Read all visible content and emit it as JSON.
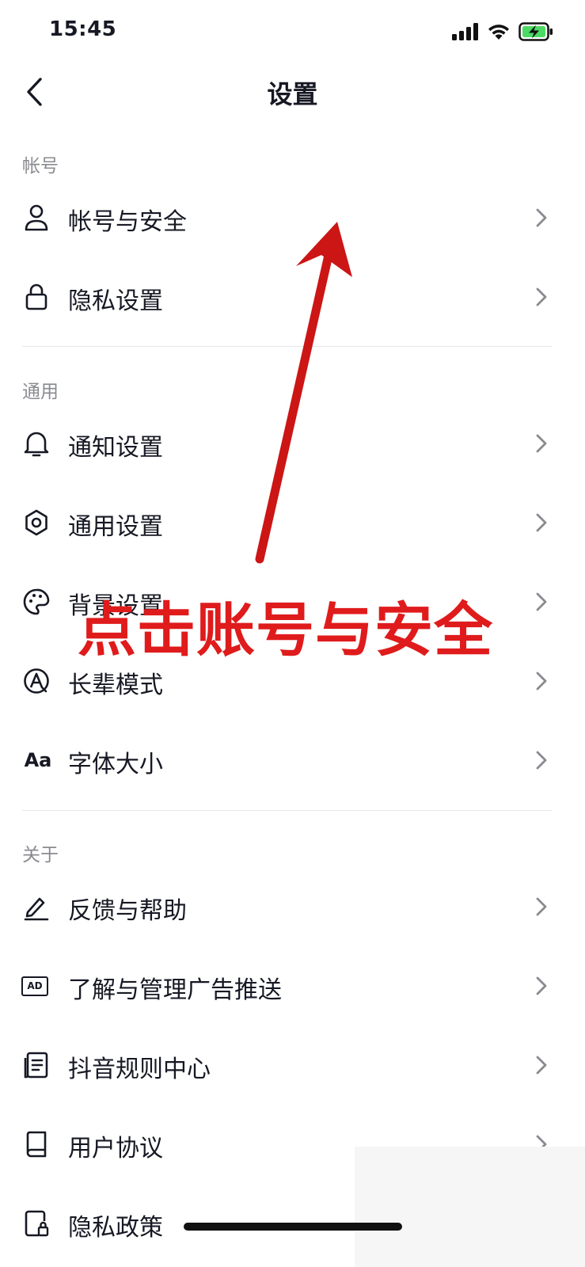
{
  "status_bar": {
    "time": "15:45",
    "battery_color": "#4cd964"
  },
  "header": {
    "title": "设置"
  },
  "sections": [
    {
      "label": "帐号",
      "items": [
        {
          "label": "帐号与安全",
          "icon": "person-icon"
        },
        {
          "label": "隐私设置",
          "icon": "lock-icon"
        }
      ]
    },
    {
      "label": "通用",
      "items": [
        {
          "label": "通知设置",
          "icon": "bell-icon"
        },
        {
          "label": "通用设置",
          "icon": "gear-icon"
        },
        {
          "label": "背景设置",
          "icon": "palette-icon"
        },
        {
          "label": "长辈模式",
          "icon": "elder-mode-icon"
        },
        {
          "label": "字体大小",
          "icon": "font-size-icon",
          "icon_text": "Aa"
        }
      ]
    },
    {
      "label": "关于",
      "items": [
        {
          "label": "反馈与帮助",
          "icon": "pencil-icon"
        },
        {
          "label": "了解与管理广告推送",
          "icon": "ad-icon",
          "icon_text": "AD"
        },
        {
          "label": "抖音规则中心",
          "icon": "document-icon"
        },
        {
          "label": "用户协议",
          "icon": "book-icon"
        },
        {
          "label": "隐私政策",
          "icon": "privacy-doc-icon"
        }
      ]
    }
  ],
  "annotation": {
    "text": "点击账号与安全",
    "color": "#e01b1b"
  }
}
